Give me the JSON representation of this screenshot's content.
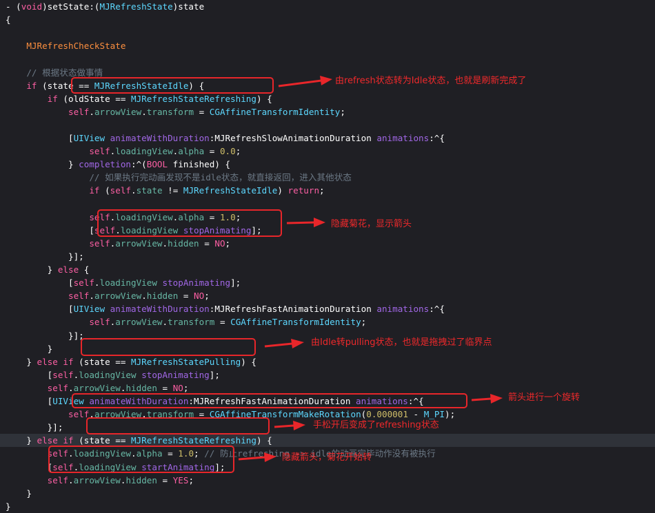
{
  "code": {
    "lines": [
      [
        [
          "plain",
          "- ("
        ],
        [
          "kw",
          "void"
        ],
        [
          "plain",
          ")setState:("
        ],
        [
          "type",
          "MJRefreshState"
        ],
        [
          "plain",
          ")state"
        ]
      ],
      [
        [
          "plain",
          "{"
        ]
      ],
      [],
      [
        [
          "plain",
          "    "
        ],
        [
          "macro",
          "MJRefreshCheckState"
        ]
      ],
      [],
      [
        [
          "plain",
          "    "
        ],
        [
          "cmt",
          "// 根据状态做事情"
        ]
      ],
      [
        [
          "plain",
          "    "
        ],
        [
          "kw",
          "if"
        ],
        [
          "plain",
          " (state == "
        ],
        [
          "type",
          "MJRefreshStateIdle"
        ],
        [
          "plain",
          ") {"
        ]
      ],
      [
        [
          "plain",
          "        "
        ],
        [
          "kw",
          "if"
        ],
        [
          "plain",
          " (oldState == "
        ],
        [
          "type",
          "MJRefreshStateRefreshing"
        ],
        [
          "plain",
          ") {"
        ]
      ],
      [
        [
          "plain",
          "            "
        ],
        [
          "kw",
          "self"
        ],
        [
          "plain",
          "."
        ],
        [
          "prop",
          "arrowView"
        ],
        [
          "plain",
          "."
        ],
        [
          "prop",
          "transform"
        ],
        [
          "plain",
          " = "
        ],
        [
          "type",
          "CGAffineTransformIdentity"
        ],
        [
          "plain",
          ";"
        ]
      ],
      [],
      [
        [
          "plain",
          "            ["
        ],
        [
          "type",
          "UIView"
        ],
        [
          "plain",
          " "
        ],
        [
          "method",
          "animateWithDuration"
        ],
        [
          "plain",
          ":MJRefreshSlowAnimationDuration "
        ],
        [
          "method",
          "animations"
        ],
        [
          "plain",
          ":^{"
        ]
      ],
      [
        [
          "plain",
          "                "
        ],
        [
          "kw",
          "self"
        ],
        [
          "plain",
          "."
        ],
        [
          "prop",
          "loadingView"
        ],
        [
          "plain",
          "."
        ],
        [
          "prop",
          "alpha"
        ],
        [
          "plain",
          " = "
        ],
        [
          "num",
          "0.0"
        ],
        [
          "plain",
          ";"
        ]
      ],
      [
        [
          "plain",
          "            } "
        ],
        [
          "method",
          "completion"
        ],
        [
          "plain",
          ":^("
        ],
        [
          "kw",
          "BOOL"
        ],
        [
          "plain",
          " finished) {"
        ]
      ],
      [
        [
          "plain",
          "                "
        ],
        [
          "cmt",
          "// 如果执行完动画发现不是idle状态，就直接返回，进入其他状态"
        ]
      ],
      [
        [
          "plain",
          "                "
        ],
        [
          "kw",
          "if"
        ],
        [
          "plain",
          " ("
        ],
        [
          "kw",
          "self"
        ],
        [
          "plain",
          "."
        ],
        [
          "prop",
          "state"
        ],
        [
          "plain",
          " != "
        ],
        [
          "type",
          "MJRefreshStateIdle"
        ],
        [
          "plain",
          ") "
        ],
        [
          "kw",
          "return"
        ],
        [
          "plain",
          ";"
        ]
      ],
      [],
      [
        [
          "plain",
          "                "
        ],
        [
          "kw",
          "self"
        ],
        [
          "plain",
          "."
        ],
        [
          "prop",
          "loadingView"
        ],
        [
          "plain",
          "."
        ],
        [
          "prop",
          "alpha"
        ],
        [
          "plain",
          " = "
        ],
        [
          "num",
          "1.0"
        ],
        [
          "plain",
          ";"
        ]
      ],
      [
        [
          "plain",
          "                ["
        ],
        [
          "kw",
          "self"
        ],
        [
          "plain",
          "."
        ],
        [
          "prop",
          "loadingView"
        ],
        [
          "plain",
          " "
        ],
        [
          "method",
          "stopAnimating"
        ],
        [
          "plain",
          "];"
        ]
      ],
      [
        [
          "plain",
          "                "
        ],
        [
          "kw",
          "self"
        ],
        [
          "plain",
          "."
        ],
        [
          "prop",
          "arrowView"
        ],
        [
          "plain",
          "."
        ],
        [
          "prop",
          "hidden"
        ],
        [
          "plain",
          " = "
        ],
        [
          "kw",
          "NO"
        ],
        [
          "plain",
          ";"
        ]
      ],
      [
        [
          "plain",
          "            }];"
        ]
      ],
      [
        [
          "plain",
          "        } "
        ],
        [
          "kw",
          "else"
        ],
        [
          "plain",
          " {"
        ]
      ],
      [
        [
          "plain",
          "            ["
        ],
        [
          "kw",
          "self"
        ],
        [
          "plain",
          "."
        ],
        [
          "prop",
          "loadingView"
        ],
        [
          "plain",
          " "
        ],
        [
          "method",
          "stopAnimating"
        ],
        [
          "plain",
          "];"
        ]
      ],
      [
        [
          "plain",
          "            "
        ],
        [
          "kw",
          "self"
        ],
        [
          "plain",
          "."
        ],
        [
          "prop",
          "arrowView"
        ],
        [
          "plain",
          "."
        ],
        [
          "prop",
          "hidden"
        ],
        [
          "plain",
          " = "
        ],
        [
          "kw",
          "NO"
        ],
        [
          "plain",
          ";"
        ]
      ],
      [
        [
          "plain",
          "            ["
        ],
        [
          "type",
          "UIView"
        ],
        [
          "plain",
          " "
        ],
        [
          "method",
          "animateWithDuration"
        ],
        [
          "plain",
          ":MJRefreshFastAnimationDuration "
        ],
        [
          "method",
          "animations"
        ],
        [
          "plain",
          ":^{"
        ]
      ],
      [
        [
          "plain",
          "                "
        ],
        [
          "kw",
          "self"
        ],
        [
          "plain",
          "."
        ],
        [
          "prop",
          "arrowView"
        ],
        [
          "plain",
          "."
        ],
        [
          "prop",
          "transform"
        ],
        [
          "plain",
          " = "
        ],
        [
          "type",
          "CGAffineTransformIdentity"
        ],
        [
          "plain",
          ";"
        ]
      ],
      [
        [
          "plain",
          "            }];"
        ]
      ],
      [
        [
          "plain",
          "        }"
        ]
      ],
      [
        [
          "plain",
          "    } "
        ],
        [
          "kw",
          "else if"
        ],
        [
          "plain",
          " (state == "
        ],
        [
          "type",
          "MJRefreshStatePulling"
        ],
        [
          "plain",
          ") {"
        ]
      ],
      [
        [
          "plain",
          "        ["
        ],
        [
          "kw",
          "self"
        ],
        [
          "plain",
          "."
        ],
        [
          "prop",
          "loadingView"
        ],
        [
          "plain",
          " "
        ],
        [
          "method",
          "stopAnimating"
        ],
        [
          "plain",
          "];"
        ]
      ],
      [
        [
          "plain",
          "        "
        ],
        [
          "kw",
          "self"
        ],
        [
          "plain",
          "."
        ],
        [
          "prop",
          "arrowView"
        ],
        [
          "plain",
          "."
        ],
        [
          "prop",
          "hidden"
        ],
        [
          "plain",
          " = "
        ],
        [
          "kw",
          "NO"
        ],
        [
          "plain",
          ";"
        ]
      ],
      [
        [
          "plain",
          "        ["
        ],
        [
          "type",
          "UIView"
        ],
        [
          "plain",
          " "
        ],
        [
          "method",
          "animateWithDuration"
        ],
        [
          "plain",
          ":MJRefreshFastAnimationDuration "
        ],
        [
          "method",
          "animations"
        ],
        [
          "plain",
          ":^{"
        ]
      ],
      [
        [
          "plain",
          "            "
        ],
        [
          "kw",
          "self"
        ],
        [
          "plain",
          "."
        ],
        [
          "prop",
          "arrowView"
        ],
        [
          "plain",
          "."
        ],
        [
          "prop",
          "transform"
        ],
        [
          "plain",
          " = "
        ],
        [
          "type",
          "CGAffineTransformMakeRotation"
        ],
        [
          "plain",
          "("
        ],
        [
          "num",
          "0.000001"
        ],
        [
          "plain",
          " - "
        ],
        [
          "type",
          "M_PI"
        ],
        [
          "plain",
          ");"
        ]
      ],
      [
        [
          "plain",
          "        }];"
        ]
      ],
      [
        [
          "plain",
          "    } "
        ],
        [
          "kw",
          "else if"
        ],
        [
          "plain",
          " (state == "
        ],
        [
          "type",
          "MJRefreshStateRefreshing"
        ],
        [
          "plain",
          ") {"
        ]
      ],
      [
        [
          "plain",
          "        "
        ],
        [
          "kw",
          "self"
        ],
        [
          "plain",
          "."
        ],
        [
          "prop",
          "loadingView"
        ],
        [
          "plain",
          "."
        ],
        [
          "prop",
          "alpha"
        ],
        [
          "plain",
          " = "
        ],
        [
          "num",
          "1.0"
        ],
        [
          "plain",
          "; "
        ],
        [
          "cmt",
          "// 防止refreshing -> idle的动画完毕动作没有被执行"
        ]
      ],
      [
        [
          "plain",
          "        ["
        ],
        [
          "kw",
          "self"
        ],
        [
          "plain",
          "."
        ],
        [
          "prop",
          "loadingView"
        ],
        [
          "plain",
          " "
        ],
        [
          "method",
          "startAnimating"
        ],
        [
          "plain",
          "];"
        ]
      ],
      [
        [
          "plain",
          "        "
        ],
        [
          "kw",
          "self"
        ],
        [
          "plain",
          "."
        ],
        [
          "prop",
          "arrowView"
        ],
        [
          "plain",
          "."
        ],
        [
          "prop",
          "hidden"
        ],
        [
          "plain",
          " = "
        ],
        [
          "kw",
          "YES"
        ],
        [
          "plain",
          ";"
        ]
      ],
      [
        [
          "plain",
          "    }"
        ]
      ],
      [
        [
          "plain",
          "}"
        ]
      ]
    ],
    "highlighted_line": 33
  },
  "annotations": [
    {
      "id": "note-1",
      "text": "由refresh状态转为Idle状态，也就是刷新完成了"
    },
    {
      "id": "note-2",
      "text": "隐藏菊花，显示箭头"
    },
    {
      "id": "note-3",
      "text": "由Idle转pulling状态，也就是拖拽过了临界点"
    },
    {
      "id": "note-4",
      "text": "箭头进行一个旋转"
    },
    {
      "id": "note-5",
      "text": "手松开后变成了refreshing状态"
    },
    {
      "id": "note-6",
      "text": "隐藏箭头，菊花开始转"
    }
  ],
  "colors": {
    "background": "#1f1f24",
    "keyword": "#fc5fa3",
    "type": "#5dd8ff",
    "property": "#67b7a4",
    "method": "#a167e6",
    "comment": "#6c7986",
    "number": "#d0bf69",
    "macro": "#fd8f3f",
    "annotation": "#e8262a"
  }
}
